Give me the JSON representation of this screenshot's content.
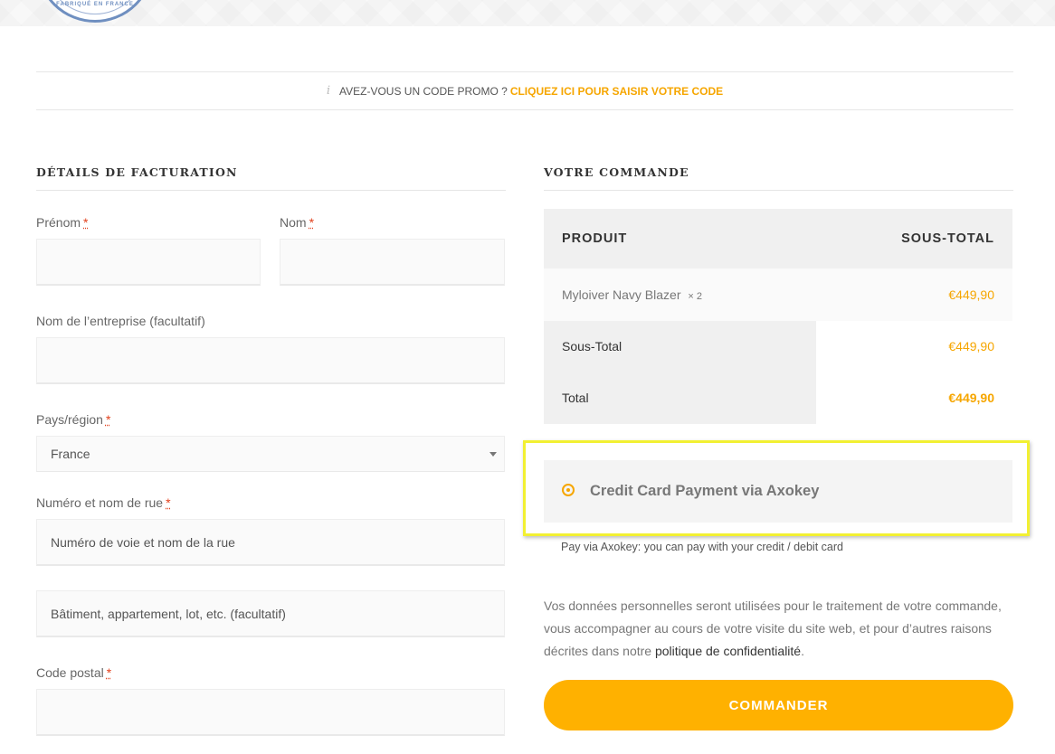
{
  "header": {
    "logo_text": "FABRIQUÉ EN FRANCE"
  },
  "promo": {
    "icon": "info-icon",
    "text": "AVEZ-VOUS UN CODE PROMO ?",
    "link": "CLIQUEZ ICI POUR SAISIR VOTRE CODE",
    "link_color": "#f6a600"
  },
  "billing": {
    "title": "DÉTAILS DE FACTURATION",
    "required_marker": "*",
    "first_name_label": "Prénom",
    "last_name_label": "Nom",
    "company_label": "Nom de l’entreprise (facultatif)",
    "country_label": "Pays/région",
    "country_value": "France",
    "street_label": "Numéro et nom de rue",
    "street_placeholder": "Numéro de voie et nom de la rue",
    "street2_placeholder": "Bâtiment, appartement, lot, etc. (facultatif)",
    "postcode_label": "Code postal"
  },
  "order": {
    "title": "VOTRE COMMANDE",
    "col_product": "PRODUIT",
    "col_subtotal": "SOUS-TOTAL",
    "item_name": "Myloiver Navy Blazer",
    "item_qty": "× 2",
    "item_price": "€449,90",
    "subtotal_label": "Sous-Total",
    "subtotal_value": "€449,90",
    "total_label": "Total",
    "total_value": "€449,90"
  },
  "payment": {
    "method_label": "Credit Card Payment via Axokey",
    "description": "Pay via Axokey: you can pay with your credit / debit card",
    "accent_color": "#f6a600",
    "highlight_color": "#f2f032"
  },
  "privacy": {
    "text": "Vos données personnelles seront utilisées pour le traitement de votre commande, vous accompagner au cours de votre visite du site web, et pour d’autres raisons décrites dans notre",
    "link": "politique de confidentialité",
    "end": "."
  },
  "submit": {
    "label": "COMMANDER",
    "color": "#ffb100"
  }
}
